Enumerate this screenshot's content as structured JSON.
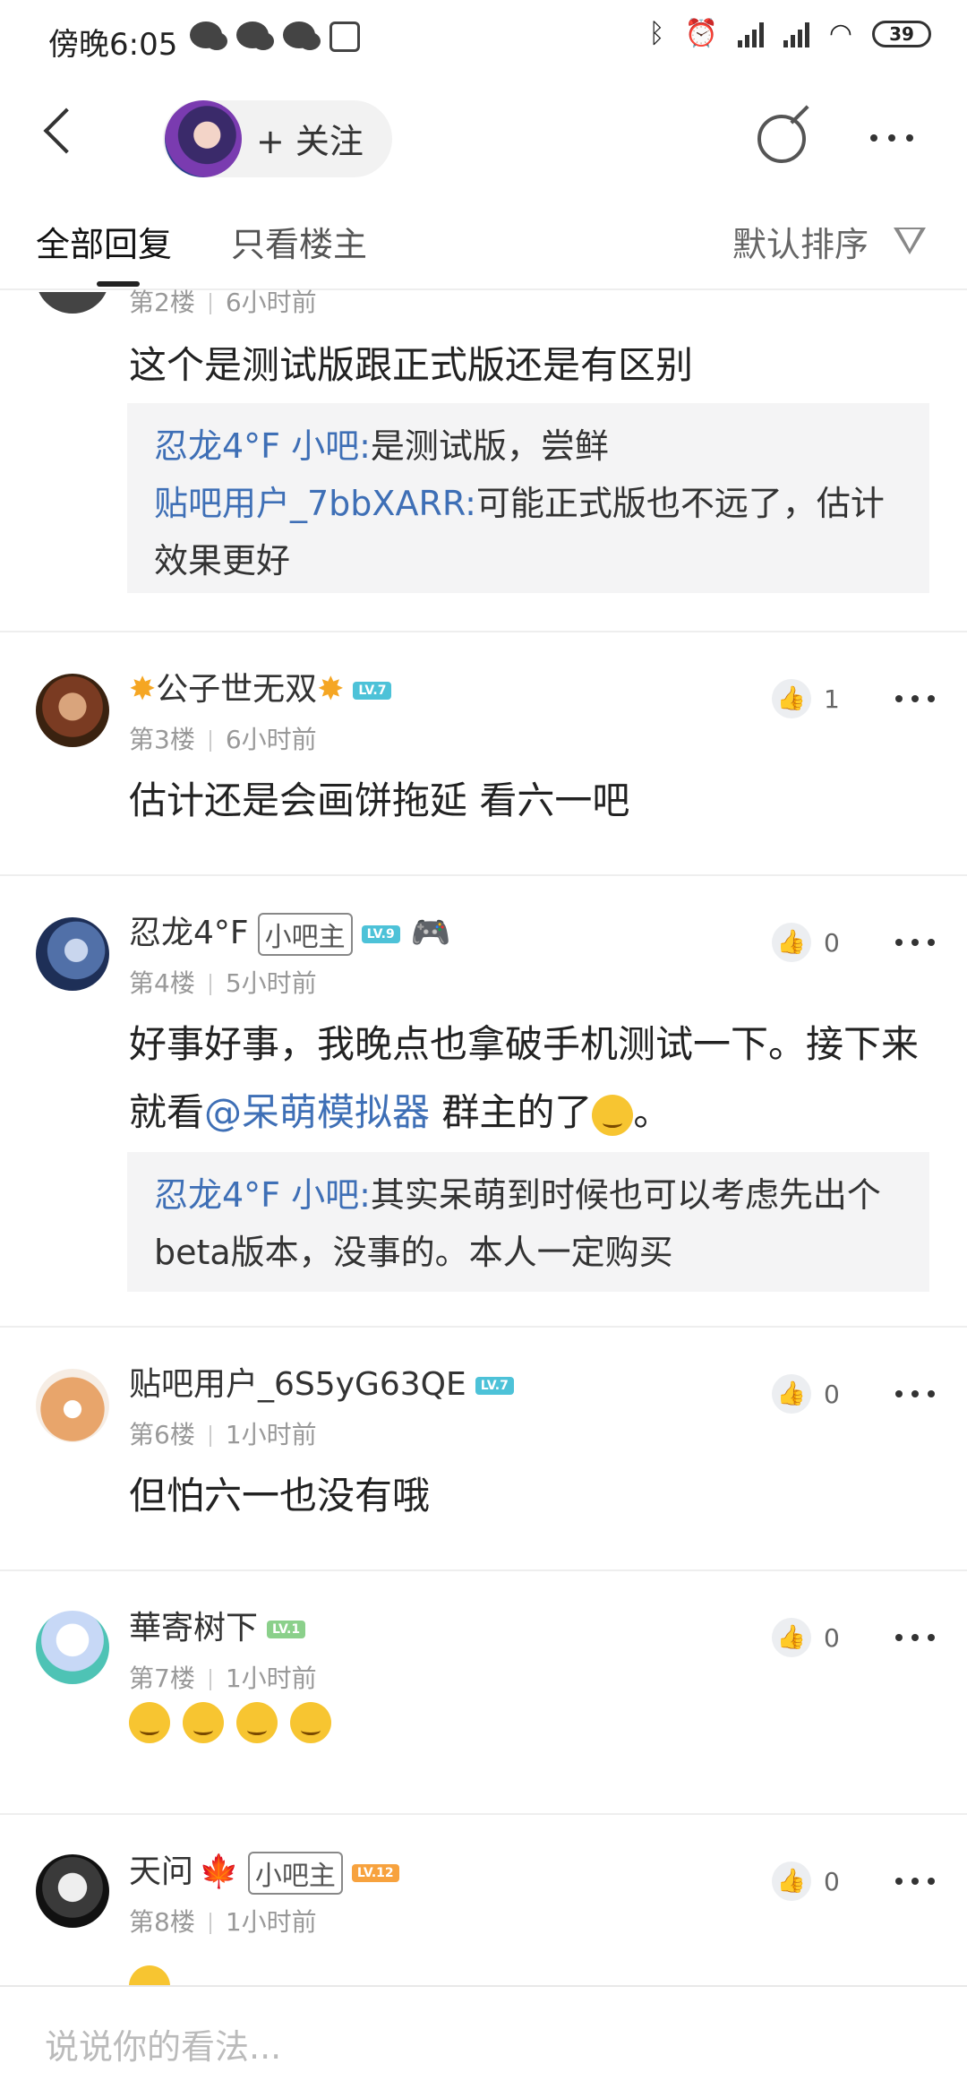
{
  "status_bar": {
    "time": "傍晚6:05",
    "battery": "39"
  },
  "header": {
    "follow_label": "+ 关注"
  },
  "tabs": {
    "all": "全部回复",
    "owner_only": "只看楼主",
    "sort": "默认排序"
  },
  "posts": [
    {
      "floor": "第2楼",
      "time": "6小时前",
      "content": "这个是测试版跟正式版还是有区别",
      "replies": [
        {
          "name": "忍龙4°F 小吧:",
          "text": "是测试版，尝鲜"
        },
        {
          "name": "贴吧用户_7bbXARR:",
          "text": "可能正式版也不远了，估计效果更好"
        }
      ]
    },
    {
      "username": "公子世无双",
      "level": "LV.7",
      "floor": "第3楼",
      "time": "6小时前",
      "likes": "1",
      "content": "估计还是会画饼拖延 看六一吧"
    },
    {
      "username": "忍龙4°F",
      "role": "小吧主",
      "level": "LV.9",
      "floor": "第4楼",
      "time": "5小时前",
      "likes": "0",
      "content_pre": "好事好事，我晚点也拿破手机测试一下。接下来就看",
      "mention": "@呆萌模拟器",
      "content_post": " 群主的了",
      "content_end": "。",
      "replies": [
        {
          "name": "忍龙4°F 小吧:",
          "text": "其实呆萌到时候也可以考虑先出个beta版本，没事的。本人一定购买"
        }
      ]
    },
    {
      "username": "贴吧用户_6S5yG63QE",
      "level": "LV.7",
      "floor": "第6楼",
      "time": "1小时前",
      "likes": "0",
      "content": "但怕六一也没有哦"
    },
    {
      "username": "華寄树下",
      "level": "LV.1",
      "floor": "第7楼",
      "time": "1小时前",
      "likes": "0"
    },
    {
      "username": "天问",
      "role": "小吧主",
      "level": "LV.12",
      "floor": "第8楼",
      "time": "1小时前",
      "likes": "0"
    }
  ],
  "reply_bar": {
    "placeholder": "说说你的看法..."
  },
  "colors": {
    "link": "#3e6fb6",
    "level_teal": "#4dc2d8",
    "level_green": "#8bd08b",
    "level_orange": "#f7a23e"
  }
}
